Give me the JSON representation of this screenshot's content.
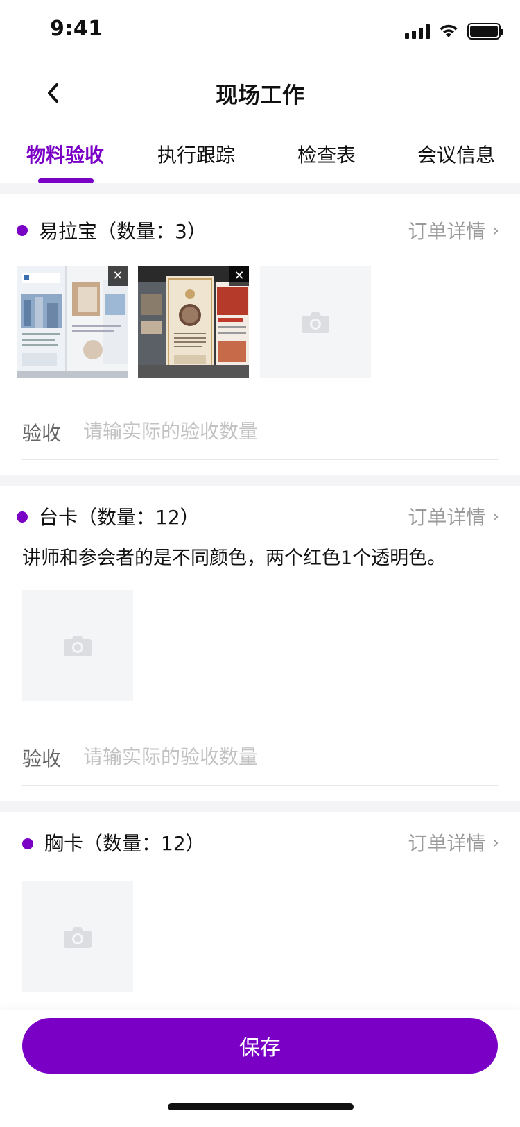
{
  "status_bar": {
    "time": "9:41",
    "icons": [
      "signal-icon",
      "wifi-icon",
      "battery-icon"
    ]
  },
  "nav": {
    "title": "现场工作",
    "back_icon": "chevron-left-icon"
  },
  "tabs": [
    {
      "label": "物料验收",
      "active": true
    },
    {
      "label": "执行跟踪",
      "active": false
    },
    {
      "label": "检查表",
      "active": false
    },
    {
      "label": "会议信息",
      "active": false
    }
  ],
  "sections": [
    {
      "title": "易拉宝（数量：3）",
      "order_link": "订单详情",
      "photos": [
        "photo",
        "photo"
      ],
      "accept_label": "验收",
      "accept_placeholder": "请输实际的验收数量"
    },
    {
      "title": "台卡（数量：12）",
      "order_link": "订单详情",
      "note": "讲师和参会者的是不同颜色，两个红色1个透明色。",
      "accept_label": "验收",
      "accept_placeholder": "请输实际的验收数量"
    },
    {
      "title": "胸卡（数量：12）",
      "order_link": "订单详情"
    }
  ],
  "save_button": "保存",
  "colors": {
    "accent": "#7B00C6",
    "muted": "#999999",
    "placeholder": "#C2C2C2",
    "divider": "#F4F4F6"
  }
}
